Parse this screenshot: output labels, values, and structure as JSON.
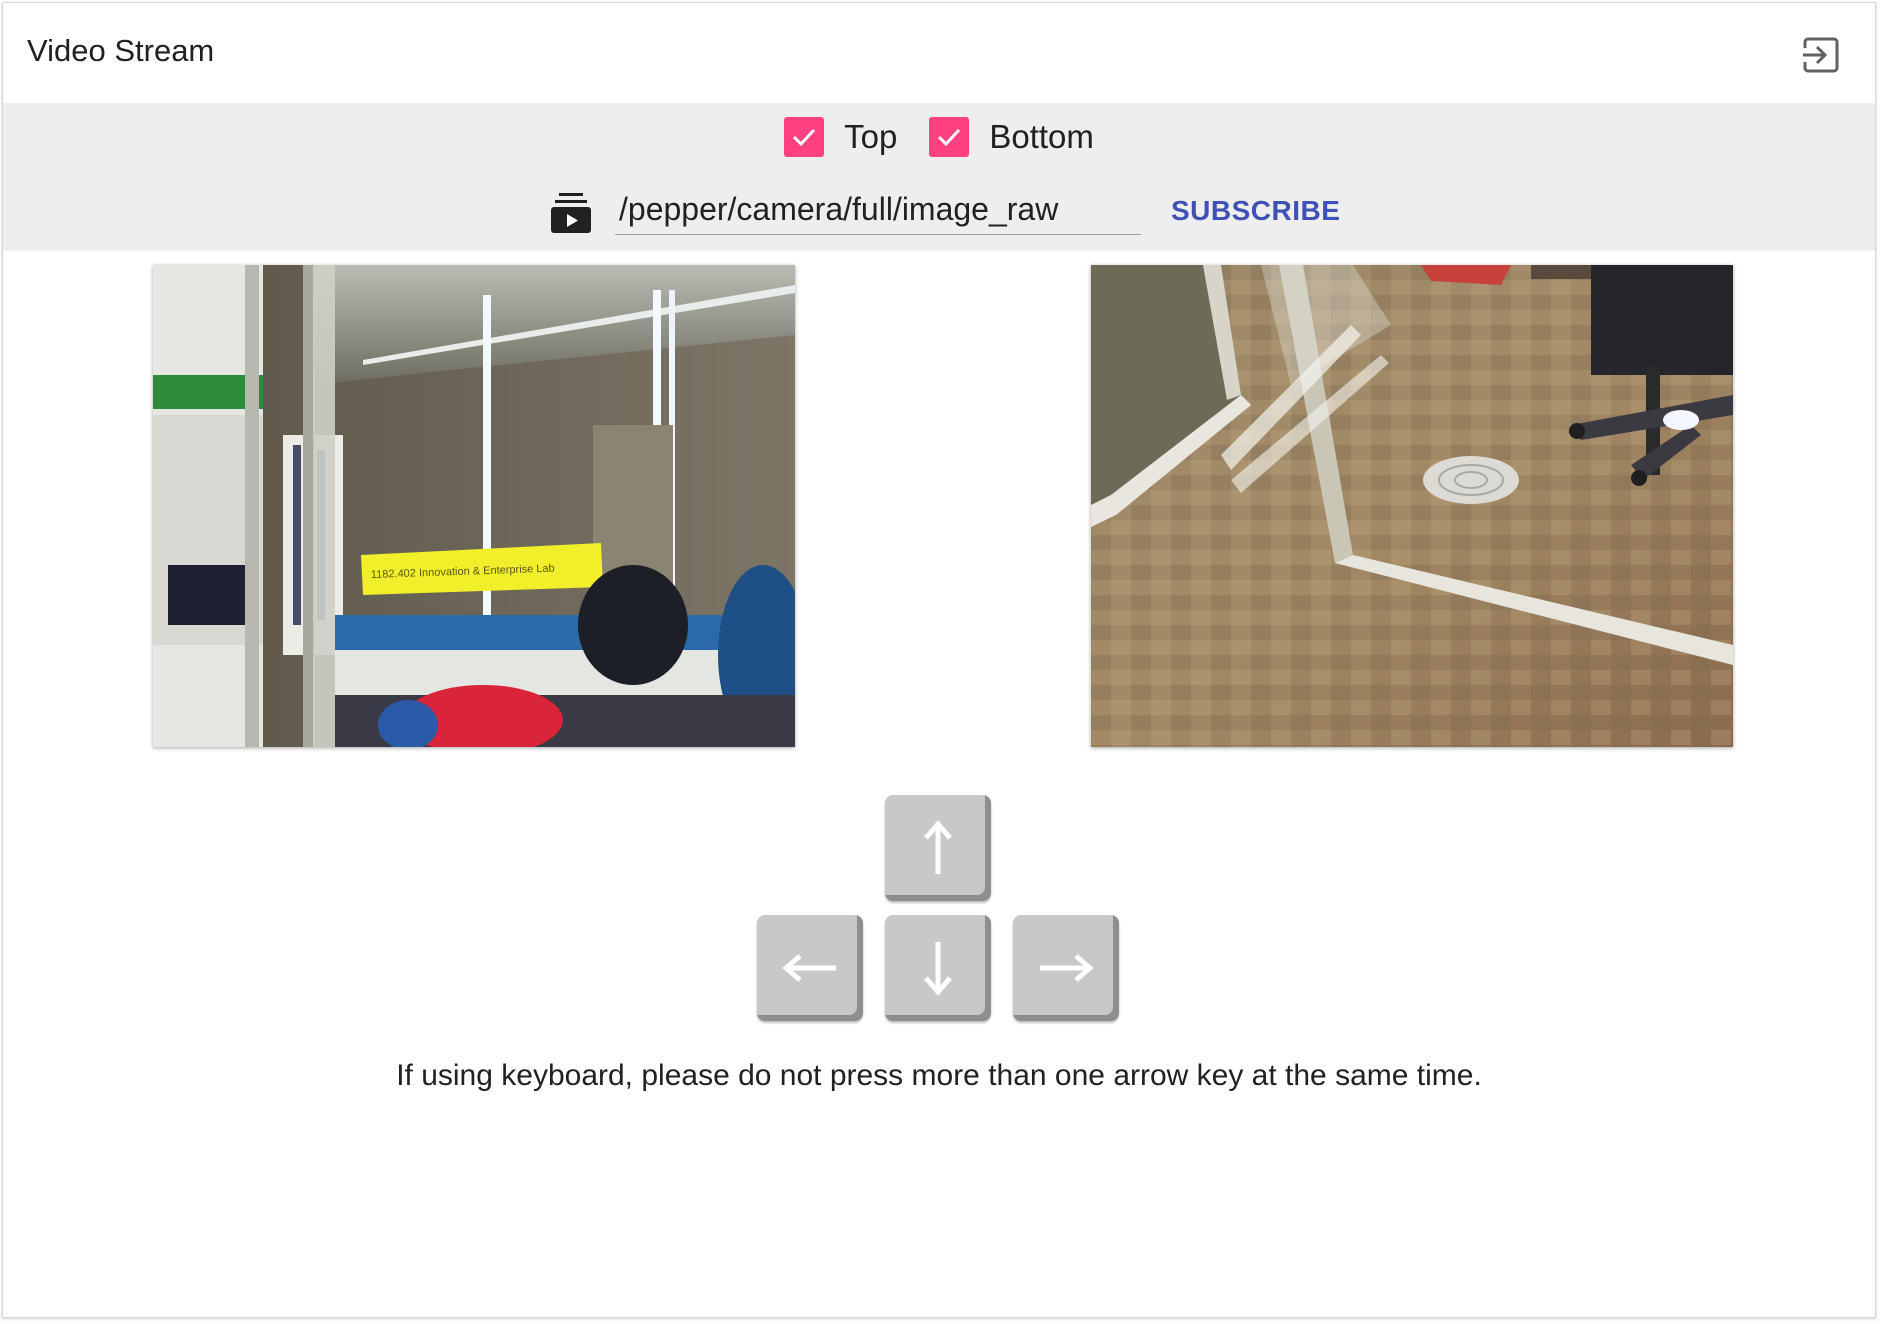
{
  "window": {
    "title": "Video Stream",
    "exit_icon": "exit-to-app-icon"
  },
  "toolbar": {
    "checkboxes": [
      {
        "label": "Top",
        "checked": true
      },
      {
        "label": "Bottom",
        "checked": true
      }
    ],
    "checkbox_color": "#ff4081",
    "topic_icon": "video-library-icon",
    "topic_value": "/pepper/camera/full/image_raw",
    "subscribe_label": "SUBSCRIBE",
    "subscribe_color": "#3f51b5"
  },
  "cameras": [
    {
      "name": "top-camera",
      "sign_text": "1182.402  Innovation & Enterprise Lab"
    },
    {
      "name": "bottom-camera"
    }
  ],
  "arrow_keys": {
    "icons": [
      "arrow-up-icon",
      "arrow-left-icon",
      "arrow-down-icon",
      "arrow-right-icon"
    ]
  },
  "hint": "If using keyboard, please do not press more than one arrow key at the same time."
}
